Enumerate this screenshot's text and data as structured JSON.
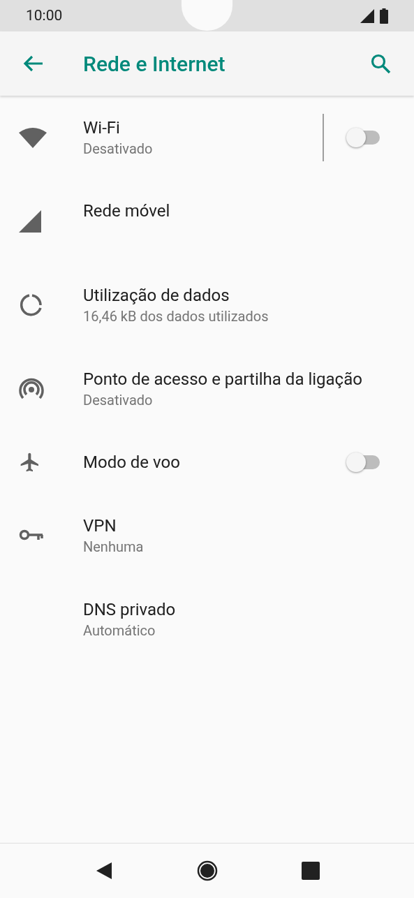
{
  "status_bar": {
    "time": "10:00"
  },
  "app_bar": {
    "title": "Rede e Internet"
  },
  "items": [
    {
      "title": "Wi-Fi",
      "subtitle": "Desativado",
      "kind": "switch",
      "on": false,
      "divider": true
    },
    {
      "title": "Rede móvel",
      "kind": "link"
    },
    {
      "title": "Utilização de dados",
      "subtitle": "16,46 kB dos dados utilizados",
      "kind": "link"
    },
    {
      "title": "Ponto de acesso e partilha da ligação",
      "subtitle": "Desativado",
      "kind": "link"
    },
    {
      "title": "Modo de voo",
      "kind": "switch",
      "on": false,
      "divider": false
    },
    {
      "title": "VPN",
      "subtitle": "Nenhuma",
      "kind": "link"
    },
    {
      "title": "DNS privado",
      "subtitle": "Automático",
      "kind": "link"
    }
  ]
}
